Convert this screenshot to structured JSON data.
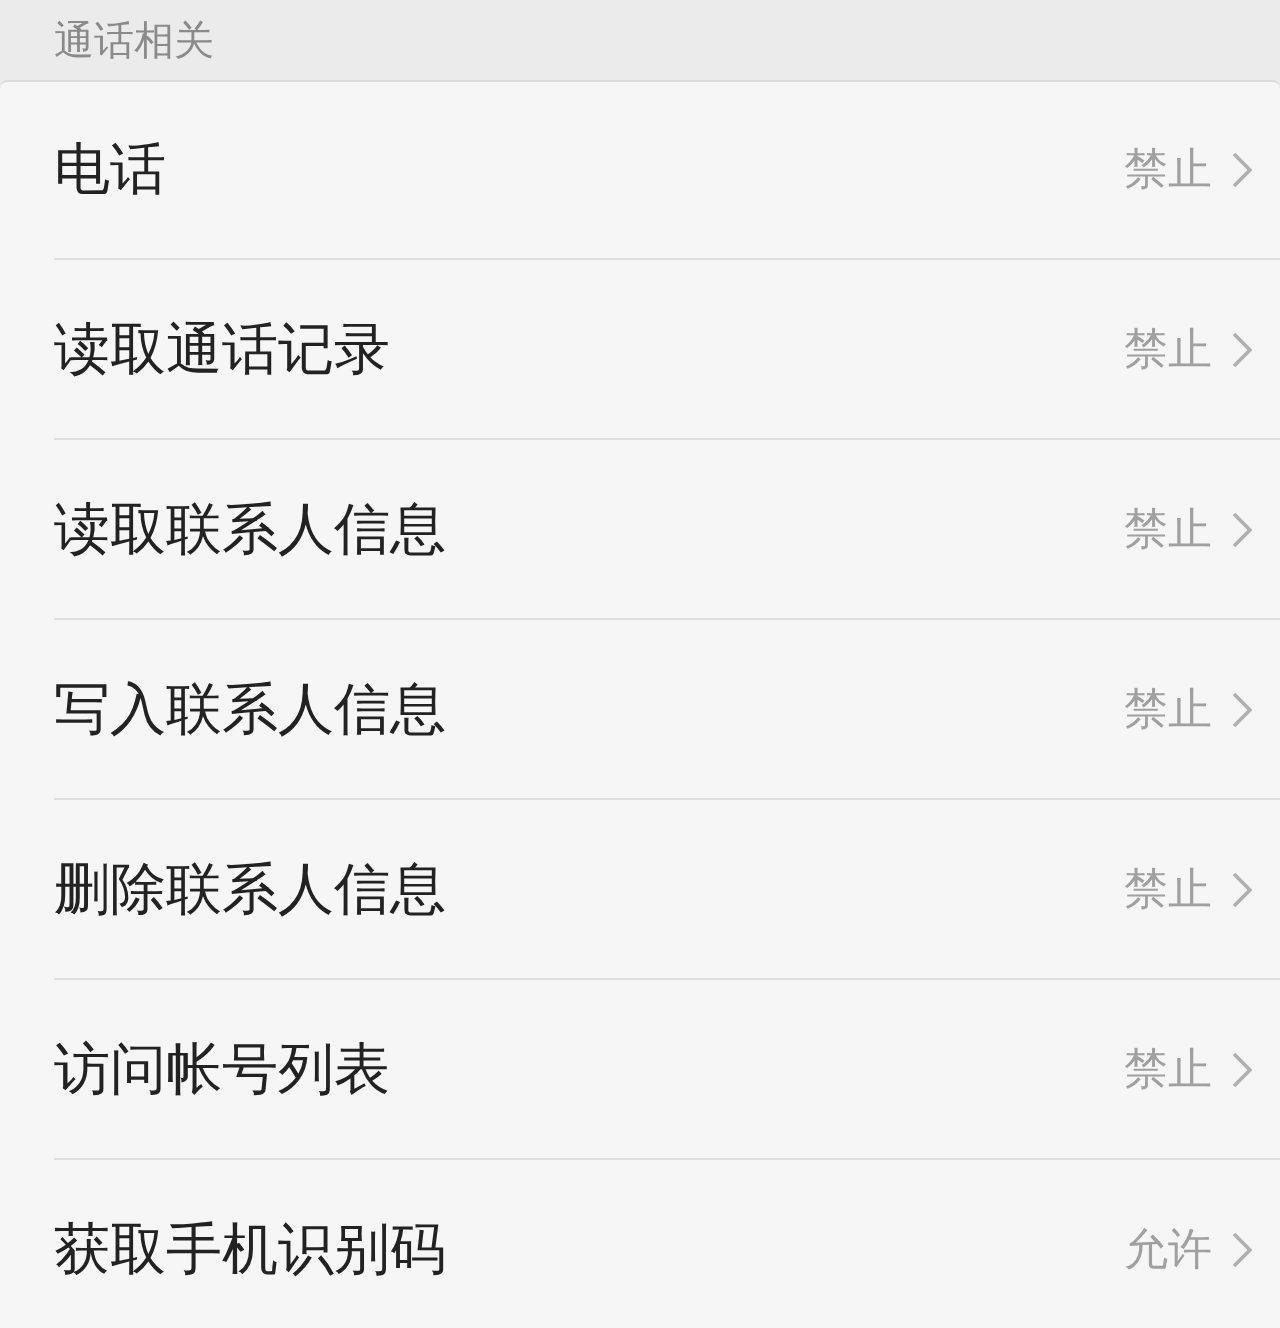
{
  "section": {
    "title": "通话相关"
  },
  "rows": [
    {
      "label": "电话",
      "value": "禁止"
    },
    {
      "label": "读取通话记录",
      "value": "禁止"
    },
    {
      "label": "读取联系人信息",
      "value": "禁止"
    },
    {
      "label": "写入联系人信息",
      "value": "禁止"
    },
    {
      "label": "删除联系人信息",
      "value": "禁止"
    },
    {
      "label": "访问帐号列表",
      "value": "禁止"
    },
    {
      "label": "获取手机识别码",
      "value": "允许"
    }
  ]
}
